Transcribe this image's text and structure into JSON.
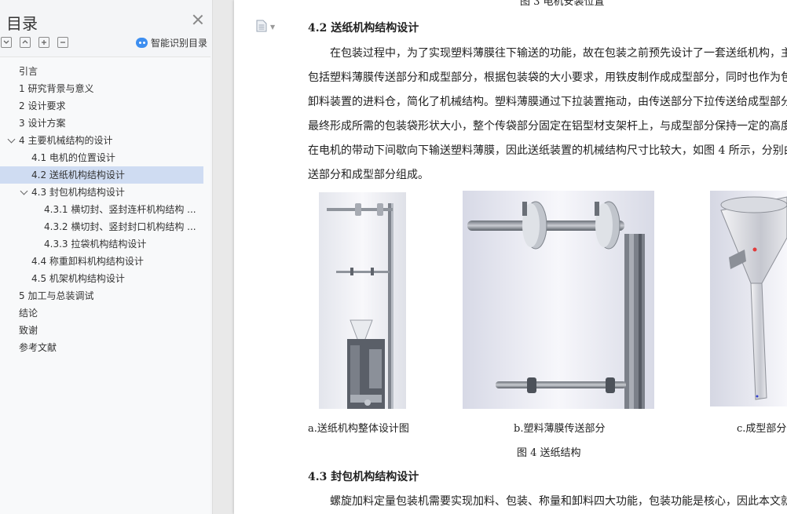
{
  "sidebar": {
    "title": "目录",
    "smart_toc_label": "智能识别目录",
    "toc": [
      {
        "label": "引言"
      },
      {
        "label": "1 研究背景与意义"
      },
      {
        "label": "2 设计要求"
      },
      {
        "label": "3 设计方案"
      },
      {
        "label": "4 主要机械结构的设计"
      },
      {
        "label": "4.1 电机的位置设计"
      },
      {
        "label": "4.2 送纸机构结构设计"
      },
      {
        "label": "4.3 封包机构结构设计"
      },
      {
        "label": "4.3.1 横切封、竖封连杆机构结构 ..."
      },
      {
        "label": "4.3.2 横切封、竖封封口机构结构 ..."
      },
      {
        "label": "4.3.3 拉袋机构结构设计"
      },
      {
        "label": "4.4 称重卸料机构结构设计"
      },
      {
        "label": "4.5 机架机构结构设计"
      },
      {
        "label": "5 加工与总装调试"
      },
      {
        "label": "结论"
      },
      {
        "label": "致谢"
      },
      {
        "label": "参考文献"
      }
    ]
  },
  "document": {
    "top_cut_caption": "图 3 电机安装位置",
    "heading_42": "4.2 送纸机构结构设计",
    "para_lines": [
      "在包装过程中，为了实现塑料薄膜往下输送的功能，故在包装之前预先设计了一套送纸机构，主",
      "包括塑料薄膜传送部分和成型部分，根据包装袋的大小要求，用铁皮制作成成型部分，同时也作为包",
      "卸料装置的进料仓，简化了机械结构。塑料薄膜通过下拉装置拖动，由传送部分下拉传送给成型部分",
      "最终形成所需的包装袋形状大小，整个传袋部分固定在铝型材支架杆上，与成型部分保持一定的高度",
      "在电机的带动下间歇向下输送塑料薄膜，因此送纸装置的机械结构尺寸比较大，如图 4 所示，分别由",
      "送部分和成型部分组成。"
    ],
    "caption_a": "a.送纸机构整体设计图",
    "caption_b": "b.塑料薄膜传送部分",
    "caption_c": "c.成型部分",
    "figure_caption": "图 4 送纸结构",
    "heading_43": "4.3 封包机构结构设计",
    "para2_line": "螺旋加料定量包装机需要实现加料、包装、称量和卸料四大功能，包装功能是核心，因此本文就"
  }
}
